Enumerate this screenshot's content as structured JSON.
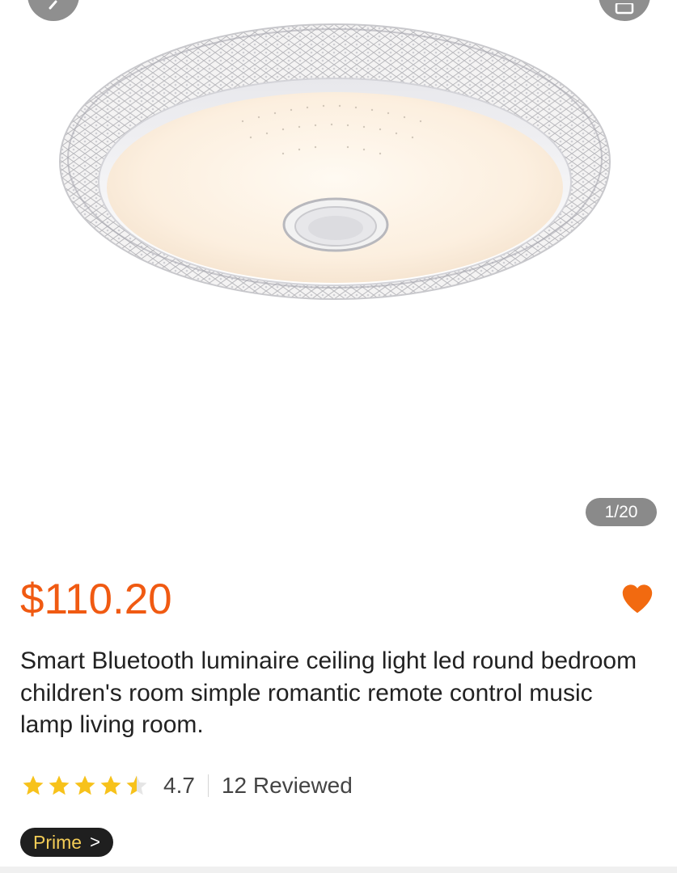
{
  "gallery": {
    "counter": "1/20",
    "image_icon": "ceiling-lamp-photo"
  },
  "nav": {
    "back_icon": "chevron-left-icon",
    "share_icon": "share-icon"
  },
  "product": {
    "price": "$110.20",
    "title": "Smart Bluetooth luminaire ceiling light led round bedroom children's room simple romantic remote control music lamp living room.",
    "favorite_icon": "heart-icon"
  },
  "rating": {
    "value": "4.7",
    "stars_filled": 4.5,
    "reviews": "12 Reviewed"
  },
  "badge": {
    "prime_label": "Prime",
    "chevron": ">"
  },
  "colors": {
    "price": "#f05a12",
    "heart": "#f26a10",
    "star": "#f7c21b",
    "prime_text": "#f3cc56"
  }
}
